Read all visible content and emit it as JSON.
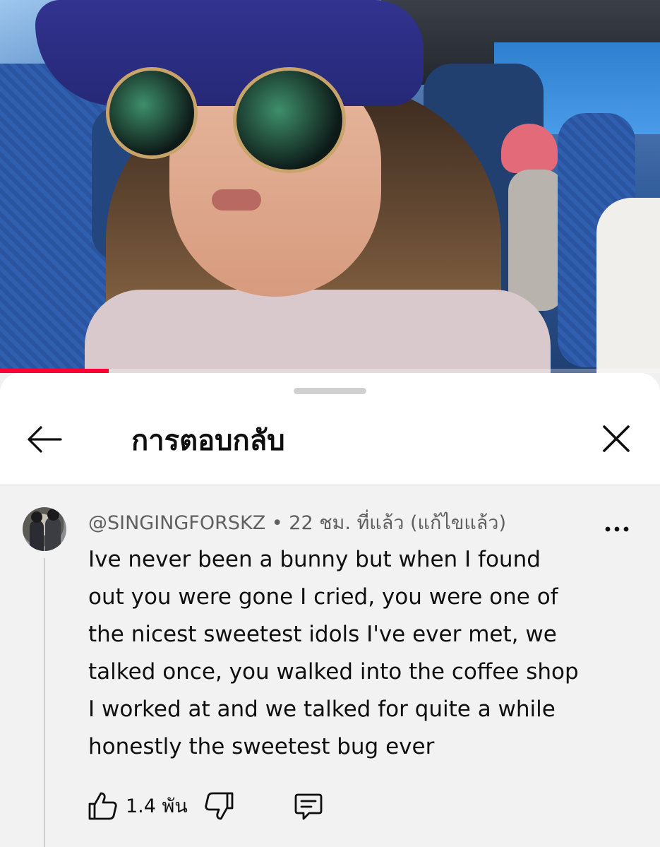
{
  "video": {
    "progress_fraction": 0.165
  },
  "panel": {
    "title": "การตอบกลับ",
    "icons": {
      "back": "arrow-left-icon",
      "close": "close-icon"
    }
  },
  "comment": {
    "author": "@SINGINGFORSKZ",
    "separator": " • ",
    "time": "22 ชม. ที่แล้ว",
    "edited": "(แก้ไขแล้ว)",
    "lines": [
      "Ive never been a bunny but when I  found",
      "out you were gone I cried, you were one of",
      "the nicest sweetest idols I've ever met, we",
      "talked once, you walked into the coffee shop",
      "I worked at and we talked for quite a while",
      "honestly the sweetest bug ever"
    ],
    "like_count": "1.4 พัน",
    "icons": {
      "like": "thumbs-up-icon",
      "dislike": "thumbs-down-icon",
      "reply": "reply-comment-icon",
      "more": "more-vertical-icon"
    }
  }
}
